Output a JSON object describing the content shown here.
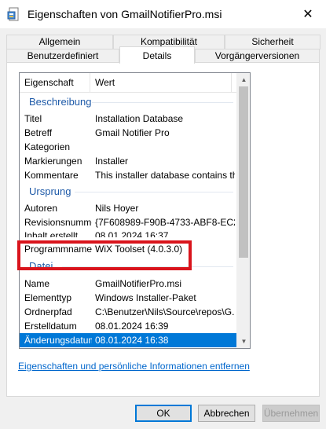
{
  "window": {
    "title": "Eigenschaften von GmailNotifierPro.msi",
    "close_glyph": "✕",
    "icon": "msi-file-icon"
  },
  "tabs_top": [
    "Allgemein",
    "Kompatibilität",
    "Sicherheit"
  ],
  "tabs_bottom": [
    "Benutzerdefiniert",
    "Details",
    "Vorgängerversionen"
  ],
  "active_tab": "Details",
  "list": {
    "headers": {
      "property": "Eigenschaft",
      "value": "Wert"
    },
    "groups": [
      {
        "name": "Beschreibung",
        "rows": [
          {
            "property": "Titel",
            "value": "Installation Database"
          },
          {
            "property": "Betreff",
            "value": "Gmail Notifier Pro"
          },
          {
            "property": "Kategorien",
            "value": ""
          },
          {
            "property": "Markierungen",
            "value": "Installer"
          },
          {
            "property": "Kommentare",
            "value": "This installer database contains th..."
          }
        ]
      },
      {
        "name": "Ursprung",
        "rows": [
          {
            "property": "Autoren",
            "value": "Nils Hoyer"
          },
          {
            "property": "Revisionsnummer",
            "value": "{7F608989-F90B-4733-ABF8-EC2..."
          },
          {
            "property": "Inhalt erstellt",
            "value": "08.01.2024 16:37"
          },
          {
            "property": "Programmname",
            "value": "WiX Toolset (4.0.3.0)"
          }
        ]
      },
      {
        "name": "Datei",
        "rows": [
          {
            "property": "Name",
            "value": "GmailNotifierPro.msi"
          },
          {
            "property": "Elementtyp",
            "value": "Windows Installer-Paket"
          },
          {
            "property": "Ordnerpfad",
            "value": "C:\\Benutzer\\Nils\\Source\\repos\\G..."
          },
          {
            "property": "Erstelldatum",
            "value": "08.01.2024 16:39"
          },
          {
            "property": "Änderungsdatum",
            "value": "08.01.2024 16:38",
            "selected": true
          }
        ]
      }
    ]
  },
  "link": "Eigenschaften und persönliche Informationen entfernen",
  "buttons": {
    "ok": "OK",
    "cancel": "Abbrechen",
    "apply": "Übernehmen"
  },
  "colors": {
    "accent": "#0078d7",
    "group_header": "#1e5aa8",
    "highlight": "#d9141c",
    "link": "#0066cc"
  }
}
